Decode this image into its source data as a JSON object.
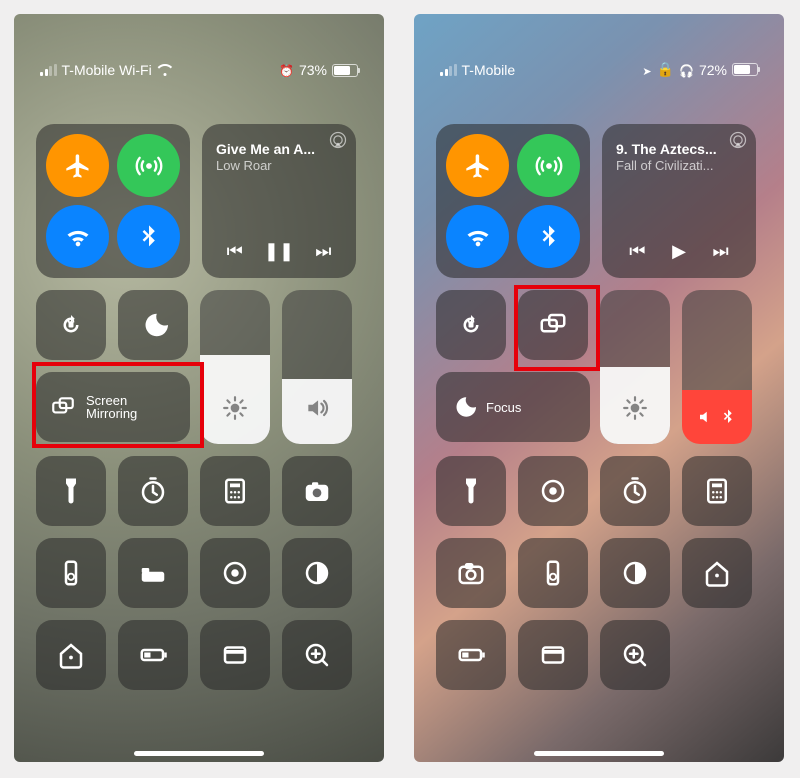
{
  "left": {
    "status": {
      "carrier": "T-Mobile Wi-Fi",
      "battery_pct": "73%",
      "battery_fill": 73
    },
    "media": {
      "title": "Give Me an A...",
      "subtitle": "Low Roar",
      "playing": true
    },
    "screen_mirroring_line1": "Screen",
    "screen_mirroring_line2": "Mirroring",
    "brightness_fill": 58,
    "volume_fill": 42
  },
  "right": {
    "status": {
      "carrier": "T-Mobile",
      "battery_pct": "72%",
      "battery_fill": 72
    },
    "media": {
      "title": "9. The Aztecs...",
      "subtitle": "Fall of Civilizati...",
      "playing": false
    },
    "focus_label": "Focus",
    "brightness_fill": 50
  }
}
